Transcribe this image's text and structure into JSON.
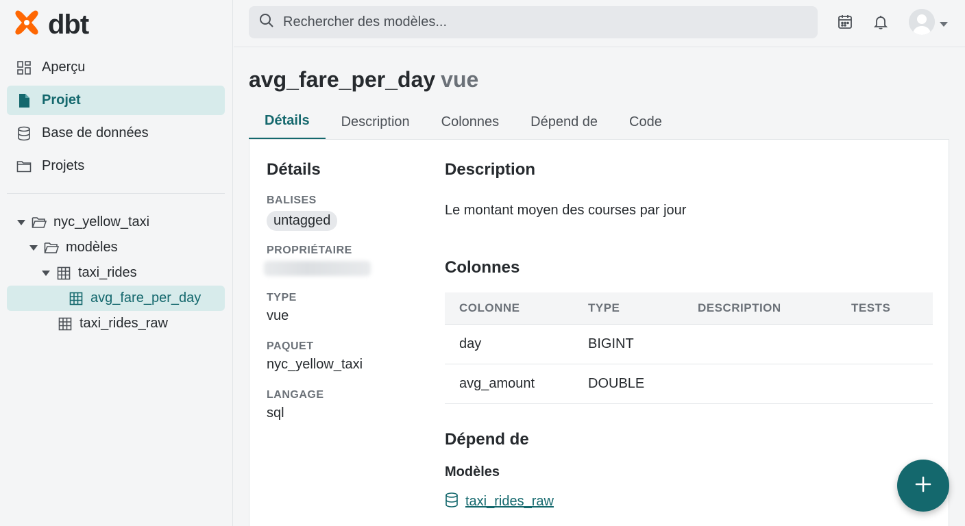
{
  "brand": {
    "name": "dbt",
    "logo_color": "#fe6703"
  },
  "colors": {
    "accent": "#14686d",
    "active_bg": "#d7ebeb"
  },
  "sidebar": {
    "nav": [
      {
        "label": "Aperçu",
        "icon": "grid-icon"
      },
      {
        "label": "Projet",
        "icon": "file-icon",
        "active": true
      },
      {
        "label": "Base de données",
        "icon": "database-icon"
      },
      {
        "label": "Projets",
        "icon": "folder-icon"
      }
    ],
    "tree": [
      {
        "label": "nyc_yellow_taxi",
        "icon": "folder-open-icon",
        "expanded": true
      },
      {
        "label": "modèles",
        "icon": "folder-open-icon",
        "expanded": true
      },
      {
        "label": "taxi_rides",
        "icon": "table-icon",
        "expanded": true
      },
      {
        "label": "avg_fare_per_day",
        "icon": "table-icon",
        "selected": true
      },
      {
        "label": "taxi_rides_raw",
        "icon": "table-icon"
      }
    ]
  },
  "topbar": {
    "search_placeholder": "Rechercher des modèles..."
  },
  "model": {
    "name": "avg_fare_per_day",
    "kind": "vue"
  },
  "tabs": [
    "Détails",
    "Description",
    "Colonnes",
    "Dépend de",
    "Code"
  ],
  "details": {
    "heading": "Détails",
    "tags_label": "BALISES",
    "tag": "untagged",
    "owner_label": "PROPRIÉTAIRE",
    "type_label": "TYPE",
    "type_value": "vue",
    "package_label": "PAQUET",
    "package_value": "nyc_yellow_taxi",
    "language_label": "LANGAGE",
    "language_value": "sql"
  },
  "description": {
    "heading": "Description",
    "text": "Le montant moyen des courses par jour"
  },
  "columns": {
    "heading": "Colonnes",
    "headers": [
      "COLONNE",
      "TYPE",
      "DESCRIPTION",
      "TESTS"
    ],
    "rows": [
      {
        "name": "day",
        "type": "BIGINT",
        "description": "",
        "tests": ""
      },
      {
        "name": "avg_amount",
        "type": "DOUBLE",
        "description": "",
        "tests": ""
      }
    ]
  },
  "depends": {
    "heading": "Dépend de",
    "subheading": "Modèles",
    "items": [
      "taxi_rides_raw"
    ]
  }
}
